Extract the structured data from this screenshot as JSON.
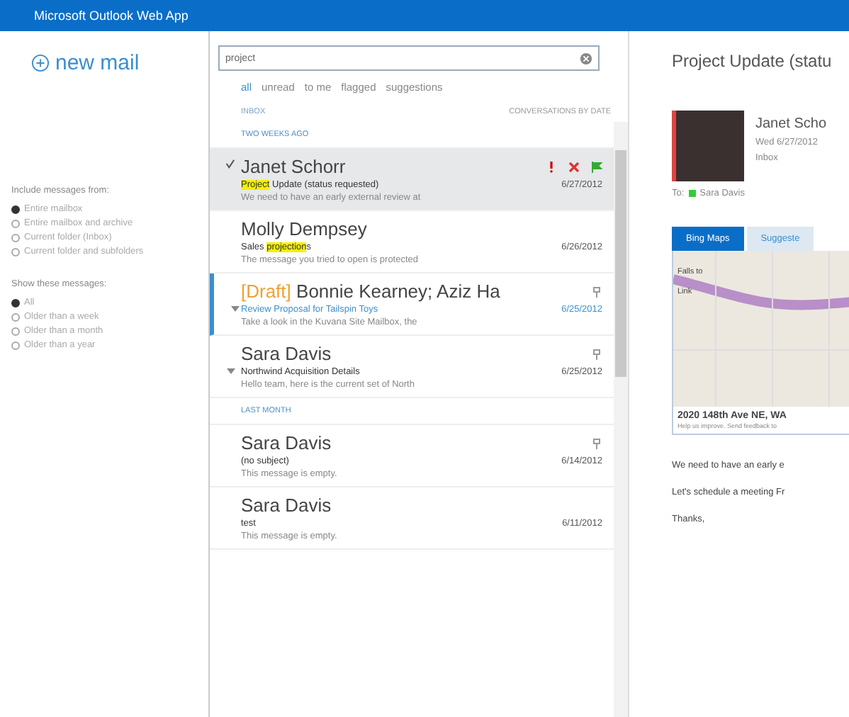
{
  "window": {
    "title": "Microsoft Outlook Web App"
  },
  "new_mail": {
    "label": "new mail"
  },
  "filters": [
    {
      "heading": "Include messages from:",
      "options": [
        {
          "label": "Entire mailbox",
          "selected": true
        },
        {
          "label": "Entire mailbox and archive",
          "selected": false
        },
        {
          "label": "Current folder (Inbox)",
          "selected": false
        },
        {
          "label": "Current folder and subfolders",
          "selected": false
        }
      ]
    },
    {
      "heading": "Show these messages:",
      "options": [
        {
          "label": "All",
          "selected": true
        },
        {
          "label": "Older than a week",
          "selected": false
        },
        {
          "label": "Older than a month",
          "selected": false
        },
        {
          "label": "Older than a year",
          "selected": false
        }
      ]
    }
  ],
  "search": {
    "value": "project"
  },
  "view_filters": [
    {
      "label": "all",
      "selected": true
    },
    {
      "label": "unread",
      "selected": false
    },
    {
      "label": "to me",
      "selected": false
    },
    {
      "label": "flagged",
      "selected": false
    },
    {
      "label": "suggestions",
      "selected": false
    }
  ],
  "list_header": {
    "folder": "INBOX",
    "sort": "CONVERSATIONS BY DATE"
  },
  "groups": [
    {
      "label": "TWO WEEKS AGO",
      "messages": [
        {
          "sender": "Janet Schorr",
          "subject": [
            {
              "kind": "match",
              "text": "Project"
            },
            {
              "kind": "plain",
              "text": " Update (status requested)"
            }
          ],
          "date": "6/27/2012",
          "preview": "We need to have an early external review at",
          "selected": true,
          "unread": false,
          "important": true,
          "flagged": true,
          "has_icon": false,
          "expandable": false
        },
        {
          "sender": "Molly Dempsey",
          "subject": [
            {
              "kind": "plain",
              "text": "Sales "
            },
            {
              "kind": "match",
              "text": "projection"
            },
            {
              "kind": "plain",
              "text": "s"
            }
          ],
          "date": "6/26/2012",
          "preview": "The message you tried to open is protected",
          "selected": false,
          "unread": false,
          "important": false,
          "flagged": false,
          "has_icon": false,
          "expandable": false
        },
        {
          "sender": "Bonnie Kearney; Aziz Ha",
          "draft_label": "[Draft]",
          "subject": [
            {
              "kind": "plain",
              "text": "Review Proposal for Tailspin Toys"
            }
          ],
          "date": "6/25/2012",
          "preview": "Take a look in the Kuvana Site Mailbox, the",
          "selected": false,
          "unread": true,
          "important": false,
          "flagged": false,
          "has_icon": true,
          "expandable": true
        },
        {
          "sender": "Sara Davis",
          "subject": [
            {
              "kind": "plain",
              "text": "Northwind Acquisition Details"
            }
          ],
          "date": "6/25/2012",
          "preview": "Hello team, here is the current set of North",
          "selected": false,
          "unread": false,
          "important": false,
          "flagged": false,
          "has_icon": true,
          "expandable": true
        }
      ]
    },
    {
      "label": "LAST MONTH",
      "messages": [
        {
          "sender": "Sara Davis",
          "subject": [
            {
              "kind": "plain",
              "text": "(no subject)"
            }
          ],
          "date": "6/14/2012",
          "preview": "This message is empty.",
          "selected": false,
          "unread": false,
          "important": false,
          "flagged": false,
          "has_icon": true,
          "expandable": false
        },
        {
          "sender": "Sara Davis",
          "subject": [
            {
              "kind": "plain",
              "text": "test"
            }
          ],
          "date": "6/11/2012",
          "preview": "This message is empty.",
          "selected": false,
          "unread": false,
          "important": false,
          "flagged": false,
          "has_icon": false,
          "expandable": false
        }
      ]
    }
  ],
  "reading": {
    "subject": "Project Update (statu",
    "sender": "Janet Scho",
    "date": "Wed 6/27/2012",
    "folder": "Inbox",
    "to_label": "To:",
    "recipient": "Sara Davis",
    "tabs": [
      {
        "label": "Bing Maps",
        "selected": true
      },
      {
        "label": "Suggeste",
        "selected": false
      }
    ],
    "map_labels": [
      "Falls to",
      "Link"
    ],
    "address": "2020 148th Ave NE, WA",
    "feedback": "Help us improve. Send feedback to",
    "body": [
      "We need to have an early e",
      "Let's schedule a meeting Fr",
      "Thanks,"
    ]
  }
}
